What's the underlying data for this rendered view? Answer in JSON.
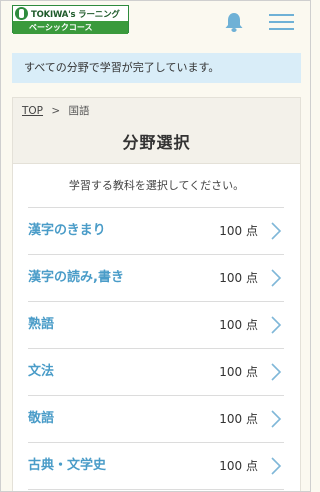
{
  "header": {
    "logo_text": "TOKIWA's ラーニング",
    "logo_sub": "ベーシックコース",
    "accent_color": "#6fb1d6",
    "brand_color": "#2e8b3d"
  },
  "notice": {
    "text": "すべての分野で学習が完了しています。"
  },
  "breadcrumb": {
    "top": "TOP",
    "separator": ">",
    "current": "国語"
  },
  "page_title": "分野選択",
  "instruction": "学習する教科を選択してください。",
  "subjects": [
    {
      "label": "漢字のきまり",
      "score": "100 点"
    },
    {
      "label": "漢字の読み,書き",
      "score": "100 点"
    },
    {
      "label": "熟語",
      "score": "100 点"
    },
    {
      "label": "文法",
      "score": "100 点"
    },
    {
      "label": "敬語",
      "score": "100 点"
    },
    {
      "label": "古典・文学史",
      "score": "100 点"
    }
  ]
}
